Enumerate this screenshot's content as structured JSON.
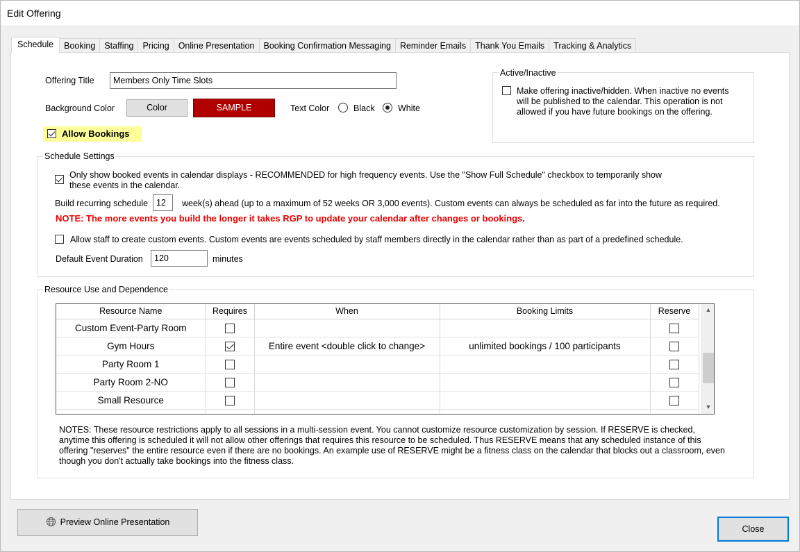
{
  "window": {
    "title": "Edit Offering"
  },
  "tabs": [
    "Schedule",
    "Booking",
    "Staffing",
    "Pricing",
    "Online Presentation",
    "Booking Confirmation Messaging",
    "Reminder Emails",
    "Thank You Emails",
    "Tracking & Analytics"
  ],
  "offering": {
    "title_label": "Offering Title",
    "title_value": "Members Only Time Slots",
    "bg_color_label": "Background Color",
    "color_button": "Color",
    "sample_label": "SAMPLE",
    "sample_color": "#b00000",
    "text_color_label": "Text Color",
    "text_color_options": [
      "Black",
      "White"
    ],
    "text_color_selected": "White",
    "allow_bookings_label": "Allow Bookings",
    "allow_bookings_checked": true
  },
  "active_inactive": {
    "title": "Active/Inactive",
    "line1": "Make offering inactive/hidden. When inactive no events",
    "line2": "will be published to the calendar.  This operation is not",
    "line3": "allowed if you have future bookings on the offering.",
    "checked": false
  },
  "schedule_settings": {
    "title": "Schedule Settings",
    "only_booked_line1": "Only show booked events in calendar displays - RECOMMENDED for high frequency events.   Use the \"Show Full Schedule\" checkbox to temporarily show",
    "only_booked_line2": "these events in the calendar.",
    "only_booked_checked": true,
    "build_label": "Build recurring schedule",
    "build_weeks": "12",
    "build_suffix": "week(s) ahead (up to a maximum of 52 weeks OR 3,000 events).  Custom events can always be scheduled as far into the future as required.",
    "note": "NOTE:  The more events you build the longer it takes RGP to update your calendar after changes or bookings.",
    "note_color": "#ee0000",
    "allow_staff_label": "Allow staff to create custom events.  Custom events are events scheduled by staff members directly in the calendar rather than as part of a predefined schedule.",
    "allow_staff_checked": false,
    "duration_label": "Default Event Duration",
    "duration_value": "120",
    "duration_suffix": "minutes"
  },
  "resources": {
    "title": "Resource Use and Dependence",
    "columns": [
      "Resource Name",
      "Requires",
      "When",
      "Booking Limits",
      "Reserve"
    ],
    "rows": [
      {
        "name": "Custom Event-Party Room",
        "requires": false,
        "when": "",
        "limits": "",
        "reserve": false
      },
      {
        "name": "Gym Hours",
        "requires": true,
        "when": "Entire event <double click to change>",
        "limits": "unlimited bookings / 100 participants",
        "reserve": false
      },
      {
        "name": "Party Room 1",
        "requires": false,
        "when": "",
        "limits": "",
        "reserve": false
      },
      {
        "name": "Party Room 2-NO",
        "requires": false,
        "when": "",
        "limits": "",
        "reserve": false
      },
      {
        "name": "Small Resource",
        "requires": false,
        "when": "",
        "limits": "",
        "reserve": false
      }
    ],
    "notes_line1": "NOTES:  These resource restrictions apply to all sessions in a multi-session event.  You cannot customize resource customization by session.   If RESERVE is checked,",
    "notes_line2": "anytime this offering is scheduled it will not allow other offerings that requires this resource to be scheduled.  Thus RESERVE means that any scheduled instance of this",
    "notes_line3": "offering \"reserves\" the entire resource even if there are no bookings.  An example use of RESERVE might be a fitness class on the calendar that blocks out a classroom, even",
    "notes_line4": "though you don't actually take bookings into the fitness class."
  },
  "footer": {
    "preview_button": "Preview Online Presentation",
    "close_button": "Close"
  },
  "icons": {
    "preview": "globe-icon"
  }
}
